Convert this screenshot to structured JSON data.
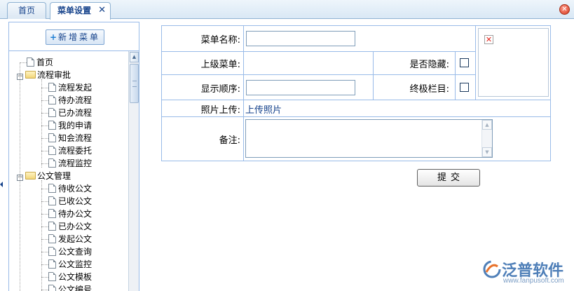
{
  "tabs": [
    {
      "label": "首页",
      "active": false
    },
    {
      "label": "菜单设置",
      "active": true
    }
  ],
  "icons": {
    "tab_close": "close-x-icon",
    "window_close": "close-circle-icon",
    "tree_doc": "document-icon",
    "tree_folder": "folder-icon",
    "broken_image": "broken-image-icon",
    "brand_logo": "fanpu-logo-icon"
  },
  "glyphs": {
    "tab_close": "✕",
    "window_close": "✕",
    "plus": "+",
    "minus": "−",
    "broken": "✕",
    "up": "▲",
    "down": "▼"
  },
  "sidebar": {
    "add_button_label": "新增菜单",
    "tree": [
      {
        "label": "首页",
        "type": "doc",
        "level": 0
      },
      {
        "label": "流程审批",
        "type": "folder",
        "level": 0,
        "expanded": true
      },
      {
        "label": "流程发起",
        "type": "doc",
        "level": 1
      },
      {
        "label": "待办流程",
        "type": "doc",
        "level": 1
      },
      {
        "label": "已办流程",
        "type": "doc",
        "level": 1
      },
      {
        "label": "我的申请",
        "type": "doc",
        "level": 1
      },
      {
        "label": "知会流程",
        "type": "doc",
        "level": 1
      },
      {
        "label": "流程委托",
        "type": "doc",
        "level": 1
      },
      {
        "label": "流程监控",
        "type": "doc",
        "level": 1
      },
      {
        "label": "公文管理",
        "type": "folder",
        "level": 0,
        "expanded": true
      },
      {
        "label": "待收公文",
        "type": "doc",
        "level": 1
      },
      {
        "label": "已收公文",
        "type": "doc",
        "level": 1
      },
      {
        "label": "待办公文",
        "type": "doc",
        "level": 1
      },
      {
        "label": "已办公文",
        "type": "doc",
        "level": 1
      },
      {
        "label": "发起公文",
        "type": "doc",
        "level": 1
      },
      {
        "label": "公文查询",
        "type": "doc",
        "level": 1
      },
      {
        "label": "公文监控",
        "type": "doc",
        "level": 1
      },
      {
        "label": "公文模板",
        "type": "doc",
        "level": 1
      },
      {
        "label": "公文编号",
        "type": "doc",
        "level": 1
      }
    ]
  },
  "form": {
    "menu_name_label": "菜单名称:",
    "menu_name_value": "",
    "parent_menu_label": "上级菜单:",
    "parent_menu_value": "",
    "hidden_label": "是否隐藏:",
    "hidden_checked": false,
    "order_label": "显示顺序:",
    "order_value": "",
    "final_label": "终极栏目:",
    "final_checked": false,
    "photo_label": "照片上传:",
    "photo_link": "上传照片",
    "remark_label": "备注:",
    "remark_value": "",
    "submit_label": "提交"
  },
  "watermark": {
    "brand": "泛普软件",
    "url": "www.fanpusoft.com"
  },
  "colors": {
    "border": "#99bbe8",
    "tab_text": "#15428b",
    "brand": "#4f7fb8",
    "close_red": "#d63a1e"
  }
}
